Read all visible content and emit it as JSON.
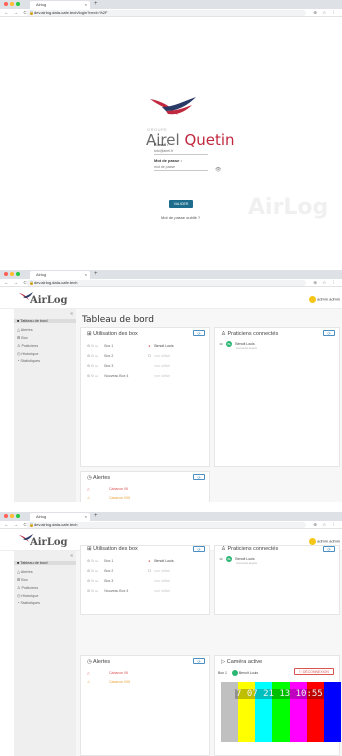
{
  "browser": {
    "tab_title": "Airlog",
    "tab_close": "×",
    "new_tab": "+",
    "nav": "←  →  C",
    "url_login": "dev.airlog.data-cafe.tech/login?next=%2F",
    "url_dash": "dev.airlog.data-cafe.tech",
    "tools": "⊕ ☆ ⋮",
    "colors": {
      "close": "#ff5f57",
      "min": "#febc2e",
      "max": "#28c840"
    }
  },
  "login": {
    "logo_small": "GROUPE",
    "logo_name_a": "Airel",
    "logo_name_b": "Quetin",
    "email_label": "E-mail :",
    "email_placeholder": "toto@airel.fr",
    "password_label": "Mot de passe :",
    "password_placeholder": "mot de passe",
    "submit": "VALIDER",
    "forgot": "Mot de passe oublié ?",
    "watermark": "AirLog"
  },
  "app": {
    "logo": "AirLog",
    "user": "admin admin",
    "sidebar": {
      "collapse": "«",
      "items": [
        {
          "icon": "■",
          "label": "Tableau de bord"
        },
        {
          "icon": "△",
          "label": "Alertes"
        },
        {
          "icon": "⊞",
          "label": "Box"
        },
        {
          "icon": "♙",
          "label": "Praticiens"
        },
        {
          "icon": "◷",
          "label": "Historique"
        },
        {
          "icon": "◔",
          "label": "Statistiques"
        }
      ]
    },
    "page_title": "Tableau de bord",
    "boxes": {
      "title": "Utilisation des box",
      "button": "⟳",
      "rows": [
        {
          "name": "Box 1",
          "occ": "●",
          "user": "Benoit Louis"
        },
        {
          "name": "Box 2",
          "occ": "☐",
          "user": "non utilisé"
        },
        {
          "name": "Box 3",
          "occ": "",
          "user": "non utilisé"
        },
        {
          "name": "Nouveau Box 4",
          "occ": "",
          "user": "non utilisé"
        }
      ]
    },
    "practitioners": {
      "title": "Praticiens connectés",
      "button": "⟳",
      "items": [
        {
          "initials": "BL",
          "name": "Benoit Louis",
          "sub": "Connecté depuis"
        }
      ]
    },
    "alerts": {
      "title": "Alertes",
      "button": "⟳",
      "rows": [
        {
          "icon": "△",
          "name": "Cabanon 06",
          "level": "red"
        },
        {
          "icon": "⚠",
          "name": "Cabanon 006",
          "level": "orange"
        }
      ]
    },
    "camera": {
      "title": "Caméra active",
      "box": "Box 1",
      "user": "Benoit Louis",
      "disconnect": "⎋ DÉCONNEXION",
      "timestamp": "7 07 21 13 10:55",
      "bar_colors": [
        "#c0c0c0",
        "#ffff00",
        "#00ffff",
        "#00ff00",
        "#ff00ff",
        "#ff0000",
        "#0000ff"
      ]
    }
  }
}
